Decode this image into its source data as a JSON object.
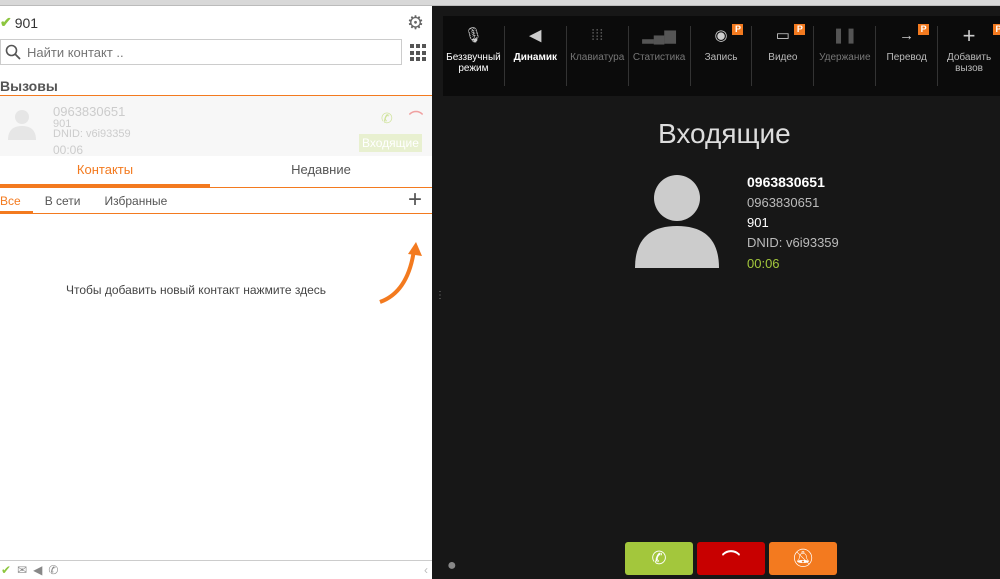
{
  "left": {
    "status": {
      "icon": "check-icon",
      "extension": "901"
    },
    "search": {
      "placeholder": "Найти контакт .."
    },
    "calls_header": "Вызовы",
    "call": {
      "number": "0963830651",
      "ext": "901",
      "dnid": "DNID: v6i93359",
      "duration": "00:06",
      "badge": "Входящие"
    },
    "tabs": [
      "Контакты",
      "Недавние"
    ],
    "subtabs": [
      "Все",
      "В сети",
      "Избранные"
    ],
    "empty_hint": "Чтобы добавить новый контакт нажмите здесь"
  },
  "toolbar": [
    {
      "label": "Беззвучный режим",
      "icon": "mic-off-icon"
    },
    {
      "label": "Динамик",
      "icon": "speaker-icon"
    },
    {
      "label": "Клавиатура",
      "icon": "keypad-icon"
    },
    {
      "label": "Статистика",
      "icon": "stats-icon"
    },
    {
      "label": "Запись",
      "icon": "record-icon",
      "badge": "P"
    },
    {
      "label": "Видео",
      "icon": "video-icon",
      "badge": "P"
    },
    {
      "label": "Удержание",
      "icon": "pause-icon"
    },
    {
      "label": "Перевод",
      "icon": "transfer-icon",
      "badge": "P"
    },
    {
      "label": "Добавить вызов",
      "icon": "plus-icon",
      "badge": "P"
    }
  ],
  "call_view": {
    "title": "Входящие",
    "number": "0963830651",
    "number2": "0963830651",
    "ext": "901",
    "dnid": "DNID: v6i93359",
    "duration": "00:06"
  },
  "colors": {
    "accent": "#f37a1f",
    "answer": "#a3c73c",
    "hangup": "#c80000"
  }
}
